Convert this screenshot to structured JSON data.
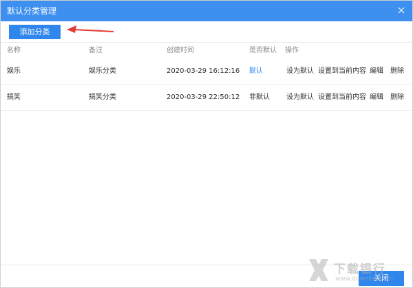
{
  "window": {
    "title": "默认分类管理",
    "accent_color": "#3d8ff0",
    "button_color": "#2f86ec",
    "arrow_color": "#e53935"
  },
  "toolbar": {
    "add_label": "添加分类"
  },
  "table": {
    "headers": {
      "name": "名称",
      "remark": "备注",
      "created": "创建时间",
      "is_default": "是否默认",
      "ops": "操作"
    },
    "rows": [
      {
        "name": "娱乐",
        "remark": "娱乐分类",
        "created": "2020-03-29 16:12:16",
        "is_default": "默认",
        "ops": {
          "set_default": "设为默认",
          "set_current": "设置到当前内容",
          "edit": "编辑",
          "delete": "删除"
        }
      },
      {
        "name": "搞笑",
        "remark": "搞笑分类",
        "created": "2020-03-29 22:50:12",
        "is_default": "非默认",
        "ops": {
          "set_default": "设为默认",
          "set_current": "设置到当前内容",
          "edit": "编辑",
          "delete": "删除"
        }
      }
    ]
  },
  "footer": {
    "close_label": "关闭"
  },
  "watermark": {
    "brand": "下载银行",
    "url": "www.downbank.cn"
  }
}
